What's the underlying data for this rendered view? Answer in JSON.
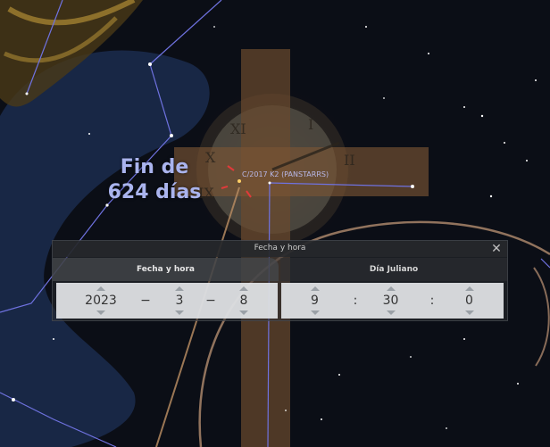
{
  "overlay": {
    "countdown_line1": "Fin de",
    "countdown_line2": "624 días",
    "comet_label": "C/2017 K2 (PANSTARRS)"
  },
  "dialog": {
    "title": "Fecha y hora",
    "close_glyph": "✕",
    "tabs": [
      {
        "label": "Fecha y hora",
        "active": true
      },
      {
        "label": "Día Juliano",
        "active": false
      }
    ],
    "date": {
      "year": "2023",
      "month": "3",
      "day": "8",
      "date_separator": "−"
    },
    "time": {
      "hour": "9",
      "minute": "30",
      "second": "0",
      "time_separator": ":"
    }
  },
  "colors": {
    "sky": "#0b0e16",
    "constellation_lines": "#6f72e0",
    "countdown_text": "#aab4ee",
    "panel_bg": "#e4e6e9"
  }
}
